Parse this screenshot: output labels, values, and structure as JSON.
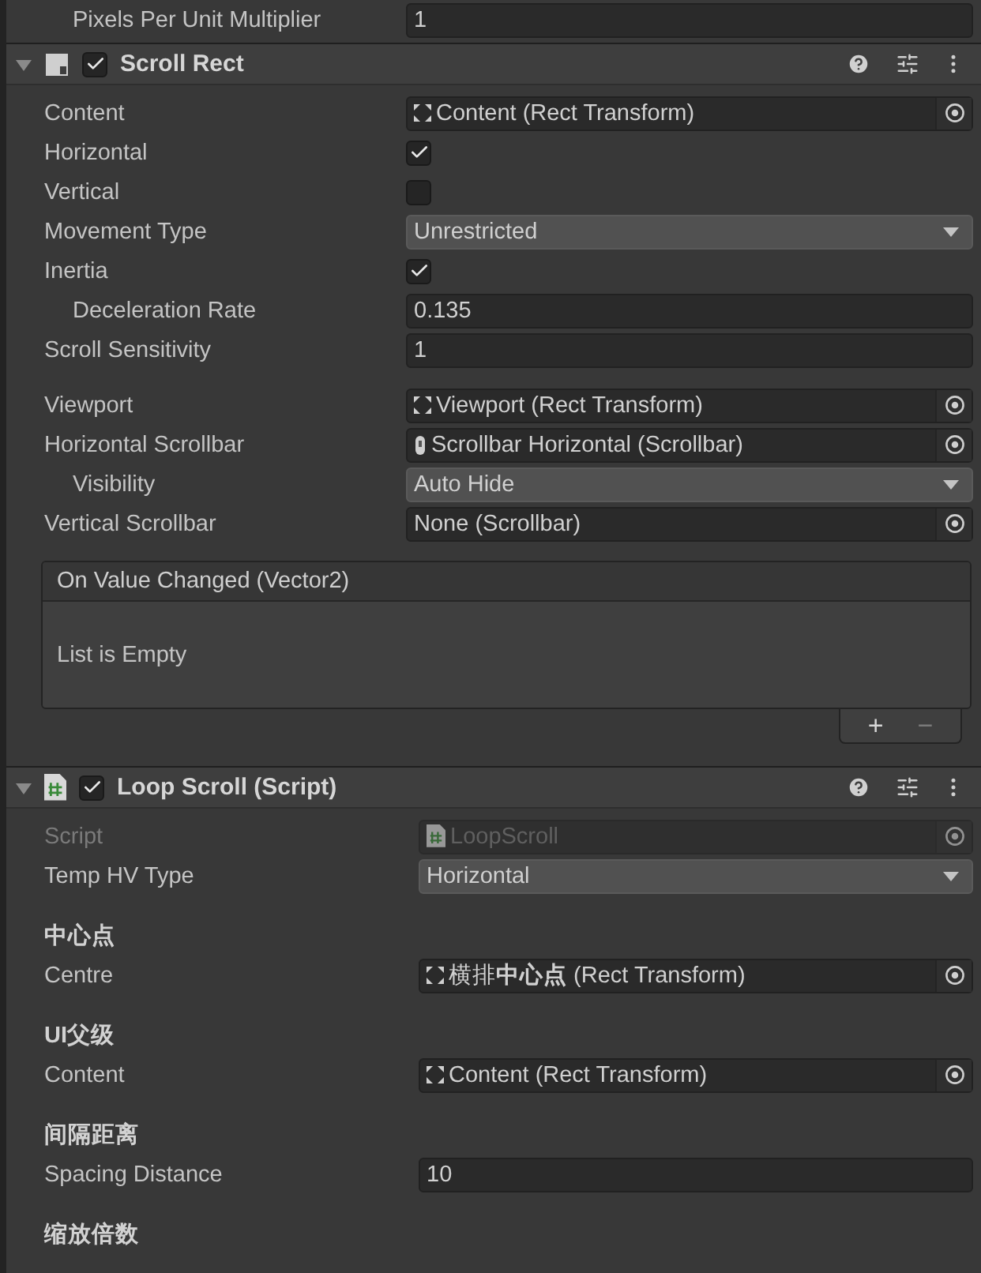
{
  "top_row": {
    "label": "Pixels Per Unit Multiplier",
    "value": "1"
  },
  "components": [
    {
      "title": "Scroll Rect",
      "kind": "builtin",
      "enabled": true,
      "expanded": true,
      "rows": [
        {
          "kind": "transform",
          "label": "Content",
          "value": "Content (Rect Transform)"
        },
        {
          "kind": "checkbox",
          "label": "Horizontal",
          "checked": true
        },
        {
          "kind": "checkbox",
          "label": "Vertical",
          "checked": false
        },
        {
          "kind": "dropdown",
          "label": "Movement Type",
          "value": "Unrestricted"
        },
        {
          "kind": "checkbox",
          "label": "Inertia",
          "checked": true,
          "children": [
            {
              "kind": "text",
              "label": "Deceleration Rate",
              "value": "0.135"
            }
          ]
        },
        {
          "kind": "text",
          "label": "Scroll Sensitivity",
          "value": "1"
        },
        {
          "kind": "spacer"
        },
        {
          "kind": "transform",
          "label": "Viewport",
          "value": "Viewport (Rect Transform)"
        },
        {
          "kind": "scrollbar",
          "label": "Horizontal Scrollbar",
          "value": "Scrollbar Horizontal (Scrollbar)",
          "children": [
            {
              "kind": "dropdown",
              "label": "Visibility",
              "value": "Auto Hide"
            }
          ]
        },
        {
          "kind": "object",
          "label": "Vertical Scrollbar",
          "value": "None (Scrollbar)"
        },
        {
          "kind": "event",
          "title": "On Value Changed (Vector2)",
          "empty_text": "List is Empty",
          "add": "+",
          "remove": "−"
        }
      ]
    },
    {
      "title": "Loop Scroll (Script)",
      "kind": "script",
      "enabled": true,
      "expanded": true,
      "rows": [
        {
          "kind": "script",
          "label": "Script",
          "value": "LoopScroll",
          "disabled": true
        },
        {
          "kind": "dropdown",
          "label": "Temp HV Type",
          "value": "Horizontal"
        },
        {
          "kind": "header",
          "label": "中心点"
        },
        {
          "kind": "transform",
          "label": "Centre",
          "value": "横排**中心点** (Rect Transform)"
        },
        {
          "kind": "header",
          "label": "UI父级"
        },
        {
          "kind": "transform",
          "label": "Content",
          "value": "Content (Rect Transform)"
        },
        {
          "kind": "header",
          "label": "间隔距离"
        },
        {
          "kind": "text",
          "label": "Spacing Distance",
          "value": "10"
        },
        {
          "kind": "header",
          "label": "缩放倍数"
        }
      ]
    }
  ]
}
